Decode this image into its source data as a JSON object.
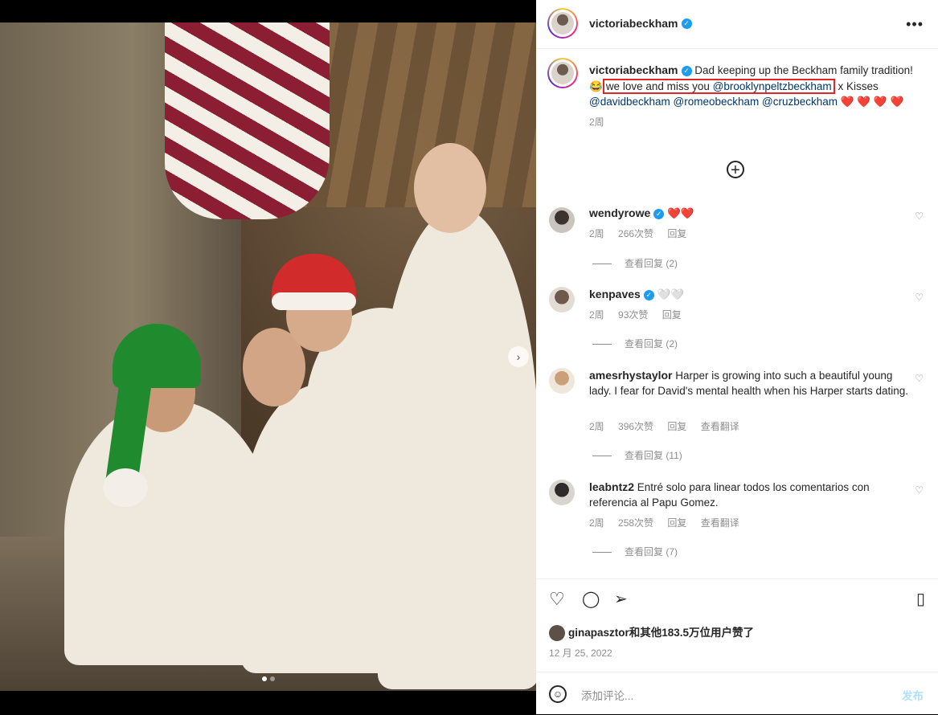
{
  "post": {
    "author": "victoriabeckham",
    "caption_text": "Dad keeping up the Beckham family tradition!",
    "caption_emoji": "😂",
    "caption_highlight": "we love and miss you",
    "caption_highlight_mention": "@brooklynpeltzbeckham",
    "caption_after": "x Kisses",
    "mentions": [
      "@davidbeckham",
      "@romeobeckham",
      "@cruzbeckham"
    ],
    "hearts": "❤️ ❤️ ❤️ ❤️",
    "age": "2周",
    "more_label": "•••",
    "load_more_label": "+"
  },
  "comments": [
    {
      "user": "wendyrowe",
      "verified": true,
      "text": "❤️❤️",
      "age": "2周",
      "likes": "266次赞",
      "reply": "回复",
      "translate": "",
      "view_replies": "查看回复 (2)"
    },
    {
      "user": "kenpaves",
      "verified": true,
      "text": "🤍🤍",
      "age": "2周",
      "likes": "93次赞",
      "reply": "回复",
      "translate": "",
      "view_replies": "查看回复 (2)"
    },
    {
      "user": "amesrhystaylor",
      "verified": false,
      "text": "Harper is growing into such a beautiful young lady. I fear for David's mental health when his Harper starts dating.",
      "age": "2周",
      "likes": "396次赞",
      "reply": "回复",
      "translate": "查看翻译",
      "view_replies": "查看回复 (11)"
    },
    {
      "user": "leabntz2",
      "verified": false,
      "text": "Entré solo para linear todos los comentarios con referencia al Papu Gomez.",
      "age": "2周",
      "likes": "258次赞",
      "reply": "回复",
      "translate": "查看翻译",
      "view_replies": "查看回复 (7)"
    }
  ],
  "footer": {
    "liked_by": "ginapasztor和其他183.5万位用户赞了",
    "date": "12 月 25, 2022",
    "comment_placeholder": "添加评论...",
    "post_button": "发布"
  },
  "colors": {
    "highlight_border": "#e0252b",
    "verified": "#1d9bf0",
    "mention": "#00376b",
    "post_button_disabled": "#b2dffc"
  },
  "icons": [
    "heart-icon",
    "comment-icon",
    "share-icon",
    "bookmark-icon",
    "emoji-icon",
    "more-icon",
    "add-circle-icon",
    "chevron-right-icon"
  ],
  "carousel": {
    "total": 2,
    "current": 1
  }
}
